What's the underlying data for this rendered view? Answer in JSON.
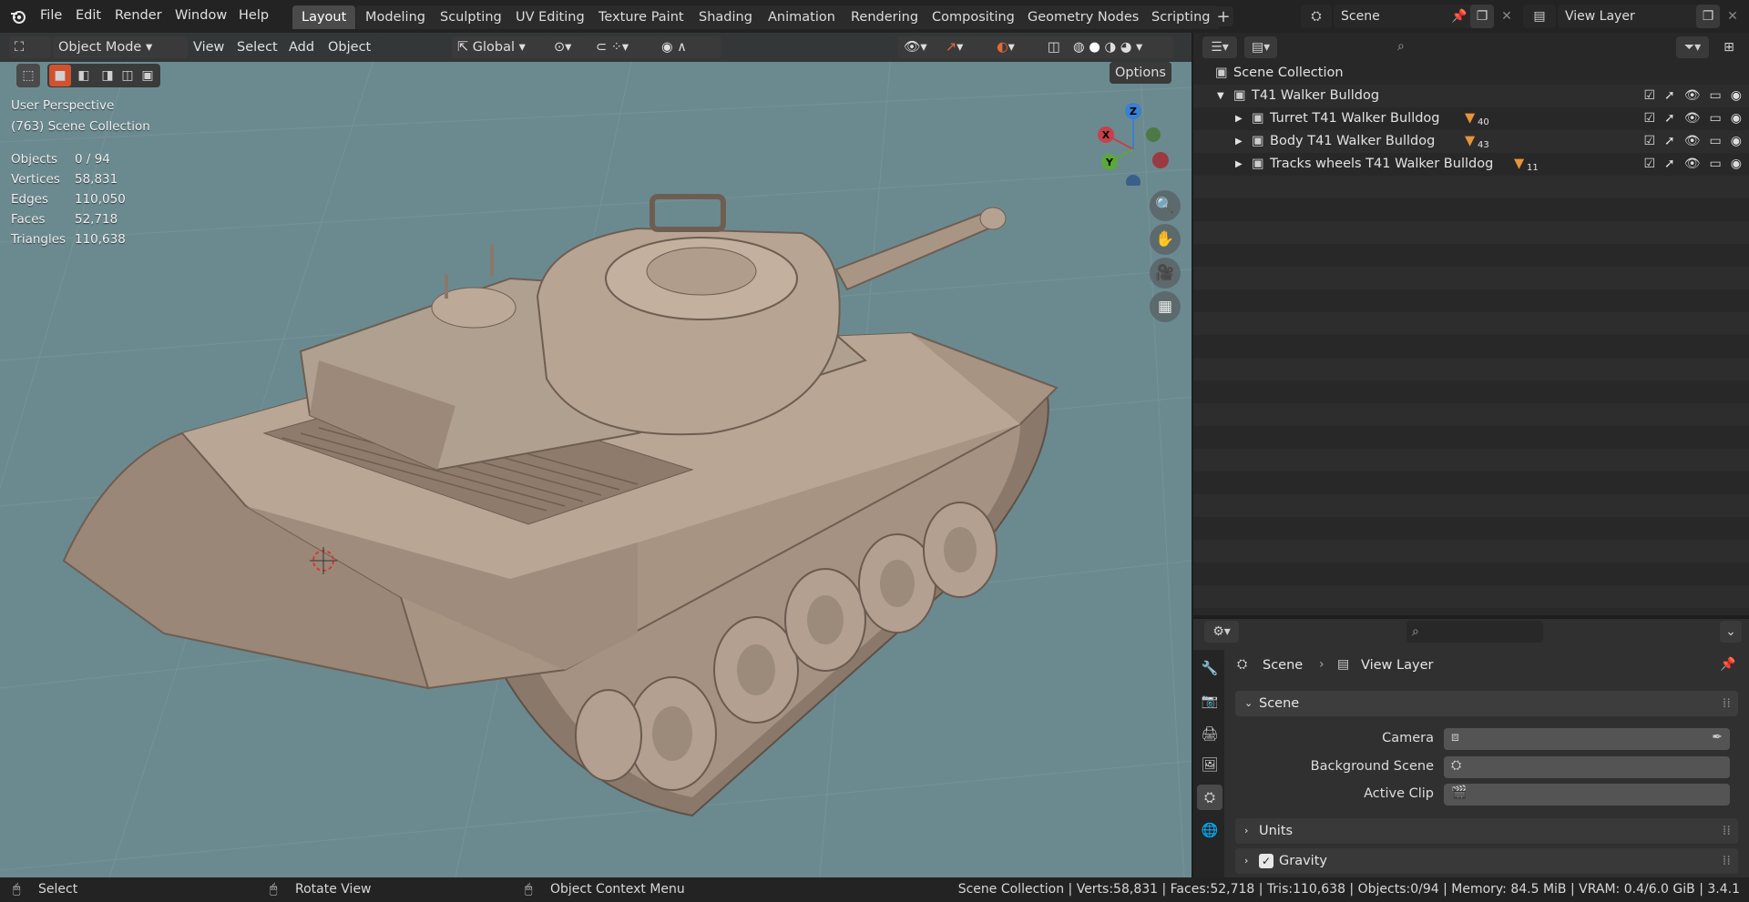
{
  "app": {
    "logo": "blender-logo-icon"
  },
  "menu": [
    "File",
    "Edit",
    "Render",
    "Window",
    "Help"
  ],
  "workspaces": [
    "Layout",
    "Modeling",
    "Sculpting",
    "UV Editing",
    "Texture Paint",
    "Shading",
    "Animation",
    "Rendering",
    "Compositing",
    "Geometry Nodes",
    "Scripting"
  ],
  "active_workspace": "Layout",
  "add_workspace": "+",
  "scene_field": "Scene",
  "view_layer_field": "View Layer",
  "viewport": {
    "mode": "Object Mode",
    "menus": [
      "View",
      "Select",
      "Add",
      "Object"
    ],
    "transform_orientation": "Global",
    "options_label": "Options",
    "perspective": "User Perspective",
    "collection": "(763) Scene Collection",
    "stats": [
      {
        "label": "Objects",
        "value": "0 / 94"
      },
      {
        "label": "Vertices",
        "value": "58,831"
      },
      {
        "label": "Edges",
        "value": "110,050"
      },
      {
        "label": "Faces",
        "value": "52,718"
      },
      {
        "label": "Triangles",
        "value": "110,638"
      }
    ],
    "gizmo_axes": {
      "x": "X",
      "y": "Y",
      "z": "Z"
    },
    "colors": {
      "background": "#6b8a90",
      "model": "#a08c7e",
      "x_axis": "#c8404a",
      "y_axis": "#5aa83c",
      "z_axis": "#3a7fd0"
    }
  },
  "outliner": {
    "root": "Scene Collection",
    "items": [
      {
        "name": "T41 Walker Bulldog",
        "count": "",
        "level": 0
      },
      {
        "name": "Turret T41 Walker Bulldog",
        "count": "40",
        "level": 1
      },
      {
        "name": "Body T41 Walker Bulldog",
        "count": "43",
        "level": 1
      },
      {
        "name": "Tracks wheels T41 Walker Bulldog",
        "count": "11",
        "level": 1
      }
    ]
  },
  "properties": {
    "breadcrumb": [
      "Scene",
      "View Layer"
    ],
    "panel_title": "Scene",
    "fields": [
      {
        "label": "Camera"
      },
      {
        "label": "Background Scene"
      },
      {
        "label": "Active Clip"
      }
    ],
    "subpanels": [
      {
        "label": "Units",
        "checkbox": false
      },
      {
        "label": "Gravity",
        "checkbox": true
      }
    ]
  },
  "statusbar": {
    "hints": [
      "Select",
      "Rotate View",
      "Object Context Menu"
    ],
    "info": "Scene Collection | Verts:58,831 | Faces:52,718 | Tris:110,638 | Objects:0/94 | Memory: 84.5 MiB | VRAM: 0.4/6.0 GiB | 3.4.1"
  }
}
